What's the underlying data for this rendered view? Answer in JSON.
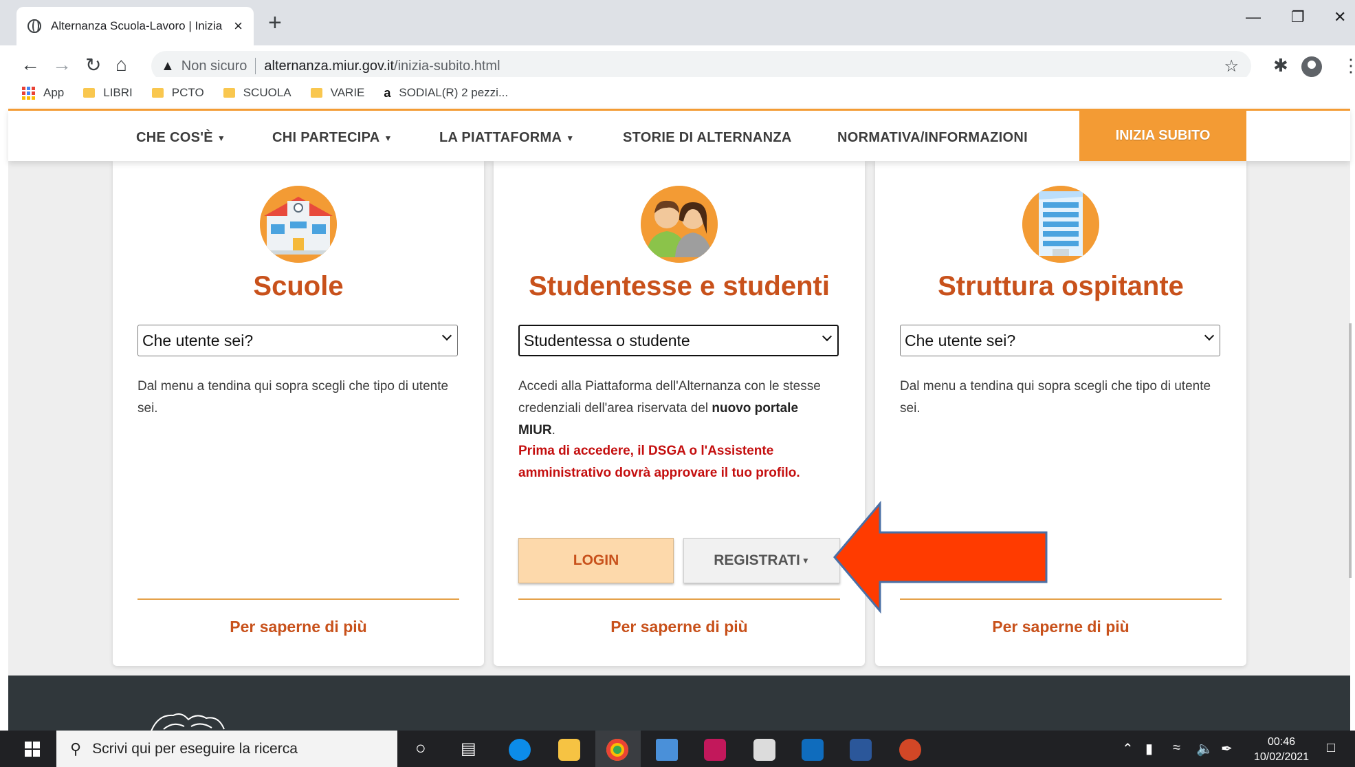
{
  "browser": {
    "tab_title": "Alternanza Scuola-Lavoro | Inizia",
    "tab_close": "×",
    "new_tab": "+",
    "security": "Non sicuro",
    "url_host": "alternanza.miur.gov.it",
    "url_path": "/inizia-subito.html",
    "bookmarks": [
      "App",
      "LIBRI",
      "PCTO",
      "SCUOLA",
      "VARIE",
      "SODIAL(R) 2 pezzi..."
    ]
  },
  "nav": {
    "items": [
      "CHE COS'È",
      "CHI PARTECIPA",
      "LA PIATTAFORMA",
      "STORIE DI ALTERNANZA",
      "NORMATIVA/INFORMAZIONI"
    ],
    "cta": "INIZIA SUBITO"
  },
  "cards": [
    {
      "title": "Scuole",
      "select_value": "Che utente sei?",
      "description": "Dal menu a tendina qui sopra scegli che tipo di utente sei.",
      "link": "Per saperne di più"
    },
    {
      "title": "Studentesse e studenti",
      "select_value": "Studentessa o studente",
      "description_pre": "Accedi alla Piattaforma dell'Alternanza con le stesse credenziali dell'area riservata del ",
      "description_bold": "nuovo portale MIUR",
      "description_post": ".",
      "note": "Prima di accedere, il DSGA o l'Assistente amministrativo dovrà approvare il tuo profilo.",
      "login_label": "LOGIN",
      "register_label": "REGISTRATI",
      "link": "Per saperne di più"
    },
    {
      "title": "Struttura ospitante",
      "select_value": "Che utente sei?",
      "description": "Dal menu a tendina qui sopra scegli che tipo di utente sei.",
      "link": "Per saperne di più"
    }
  ],
  "taskbar": {
    "search_placeholder": "Scrivi qui per eseguire la ricerca",
    "time": "00:46",
    "date": "10/02/2021"
  },
  "colors": {
    "brand_orange": "#f39b34",
    "title_orange": "#c8511b",
    "warning_red": "#c40e0e",
    "arrow_red": "#ff3b00"
  }
}
